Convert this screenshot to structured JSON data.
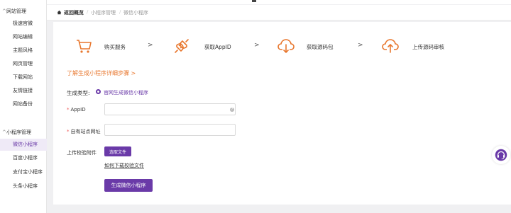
{
  "sidebar": {
    "groups": [
      {
        "label": "网站管理",
        "items": [
          {
            "label": "极速官微",
            "active": false
          },
          {
            "label": "网站编辑",
            "active": false
          },
          {
            "label": "主题风格",
            "active": false
          },
          {
            "label": "网页管理",
            "active": false
          },
          {
            "label": "下载网站",
            "active": false
          },
          {
            "label": "友情链接",
            "active": false
          },
          {
            "label": "网站备份",
            "active": false
          }
        ]
      },
      {
        "label": "小程序管理",
        "items": [
          {
            "label": "微信小程序",
            "active": true
          },
          {
            "label": "百度小程序",
            "active": false
          },
          {
            "label": "支付宝小程序",
            "active": false
          },
          {
            "label": "头条小程序",
            "active": false
          }
        ]
      }
    ]
  },
  "breadcrumb": {
    "back": "返回概览",
    "sep": "/",
    "level1": "小程序管理",
    "level2": "微信小程序"
  },
  "steps": [
    {
      "label": "购买服务",
      "icon": "cart-icon"
    },
    {
      "label": "获取AppID",
      "icon": "plug-icon"
    },
    {
      "label": "获取源码包",
      "icon": "cloud-download-icon"
    },
    {
      "label": "上传源码审核",
      "icon": "cloud-upload-icon"
    }
  ],
  "step_arrow": ">",
  "learn_link": "了解生成小程序详细步骤 >",
  "form": {
    "type_label": "生成类型:",
    "type_option": "官网生成微信小程序",
    "required_mark": "*",
    "appid_label": "AppID",
    "appid_value": "",
    "site_label": "自有站点网址",
    "site_value": "",
    "upload_label": "上传校验附件",
    "choose_file": "选取文件",
    "download_link": "如何下载校验文件",
    "submit": "生成微信小程序",
    "help_glyph": "?"
  },
  "colors": {
    "accent": "#6a3aa8",
    "orange": "#e8772e"
  }
}
